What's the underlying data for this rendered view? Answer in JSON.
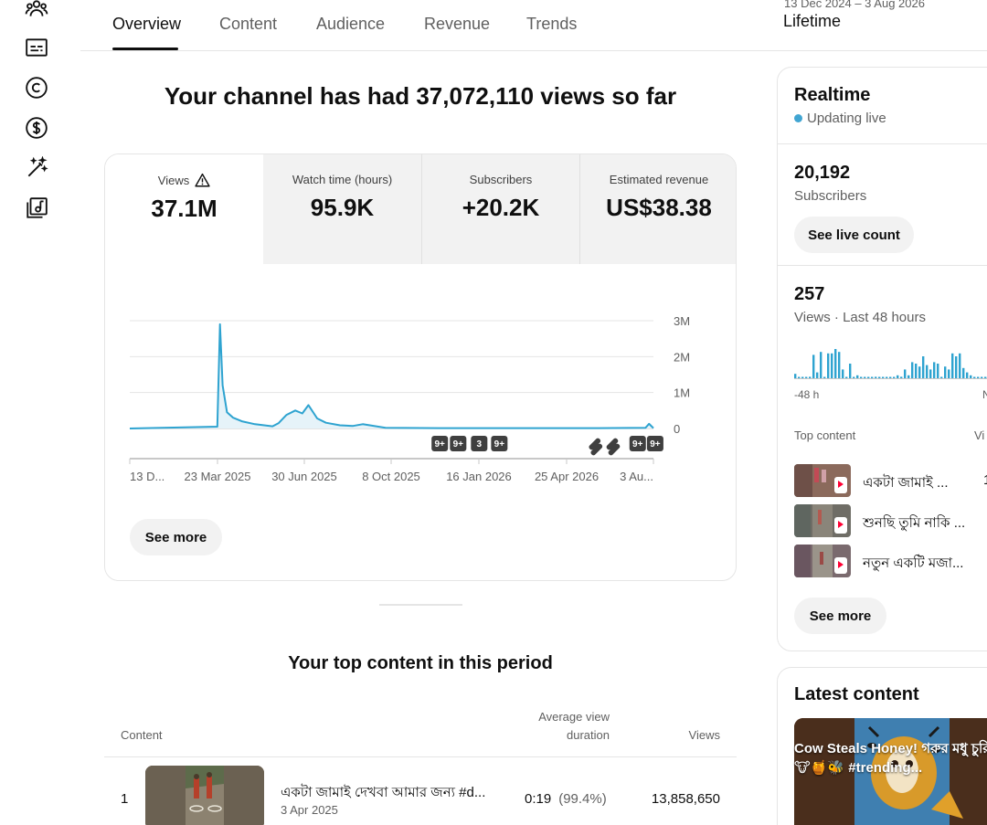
{
  "rail": {
    "icons": [
      "community-icon",
      "subtitles-icon",
      "copyright-icon",
      "earn-icon",
      "customization-icon",
      "audio-library-icon"
    ]
  },
  "tabs": [
    {
      "label": "Overview",
      "active": true
    },
    {
      "label": "Content",
      "active": false
    },
    {
      "label": "Audience",
      "active": false
    },
    {
      "label": "Revenue",
      "active": false
    },
    {
      "label": "Trends",
      "active": false
    }
  ],
  "period": {
    "range": "13 Dec 2024 – 3 Aug 2026",
    "label": "Lifetime"
  },
  "headline": "Your channel has had 37,072,110 views so far",
  "metrics": [
    {
      "label": "Views",
      "value": "37.1M",
      "active": true,
      "warning": true
    },
    {
      "label": "Watch time (hours)",
      "value": "95.9K",
      "active": false
    },
    {
      "label": "Subscribers",
      "value": "+20.2K",
      "active": false
    },
    {
      "label": "Estimated revenue",
      "value": "US$38.38",
      "active": false
    }
  ],
  "chart_data": {
    "type": "line",
    "series": [
      {
        "name": "",
        "x": [
          "13 Dec 2024",
          "23 Mar 2025",
          "26 Mar 2025",
          "29 Mar 2025",
          "3 Apr 2025",
          "10 Apr 2025",
          "20 Apr 2025",
          "5 May 2025",
          "25 May 2025",
          "1 Jun 2025",
          "10 Jun 2025",
          "20 Jun 2025",
          "28 Jun 2025",
          "5 Jul 2025",
          "15 Jul 2025",
          "25 Jul 2025",
          "10 Aug 2025",
          "25 Aug 2025",
          "5 Sep 2025",
          "1 Oct 2025",
          "1 Dec 2025",
          "1 Mar 2026",
          "1 Jun 2026",
          "25 Jul 2026",
          "29 Jul 2026",
          "3 Aug 2026"
        ],
        "values": [
          0,
          50000,
          2900000,
          1200000,
          450000,
          300000,
          200000,
          120000,
          60000,
          150000,
          380000,
          500000,
          420000,
          650000,
          280000,
          160000,
          90000,
          70000,
          120000,
          20000,
          10000,
          10000,
          10000,
          20000,
          130000,
          10000
        ]
      }
    ],
    "xticks": [
      "13 D...",
      "23 Mar 2025",
      "30 Jun 2025",
      "8 Oct 2025",
      "16 Jan 2026",
      "25 Apr 2026",
      "3 Au..."
    ],
    "yticks": [
      "3M",
      "2M",
      "1M",
      "0"
    ],
    "ylim": [
      0,
      3000000
    ],
    "grid": true,
    "markers": [
      {
        "label": "9+",
        "x": "2 Dec 2025"
      },
      {
        "label": "9+",
        "x": "23 Dec 2025"
      },
      {
        "label": "3",
        "x": "16 Jan 2026"
      },
      {
        "label": "9+",
        "x": "8 Feb 2026"
      },
      {
        "label": "",
        "x": "28 May 2026"
      },
      {
        "label": "",
        "x": "17 Jun 2026"
      },
      {
        "label": "9+",
        "x": "16 Jul 2026"
      },
      {
        "label": "9+",
        "x": "5 Aug 2026"
      }
    ],
    "line_color": "#2ea3d0"
  },
  "chart_see_more": "See more",
  "top_content": {
    "title": "Your top content in this period",
    "headers": {
      "content": "Content",
      "avd_line1": "Average view",
      "avd_line2": "duration",
      "views": "Views"
    },
    "rows": [
      {
        "rank": "1",
        "title": "একটা জামাই দেখবা আমার জন্য #d...",
        "date": "3 Apr 2025",
        "avd": "0:19",
        "avd_pct": "(99.4%)",
        "views": "13,858,650"
      }
    ]
  },
  "realtime": {
    "title": "Realtime",
    "live": "Updating live",
    "subscribers_value": "20,192",
    "subscribers_label": "Subscribers",
    "live_count_button": "See live count",
    "views_value": "257",
    "views_label": "Views · Last 48 hours",
    "axis_left": "-48 h",
    "axis_right": "N",
    "bars": [
      0.15,
      0,
      0,
      0,
      0.05,
      0.8,
      0.2,
      0.9,
      0,
      0.85,
      0.85,
      1.0,
      0.9,
      0.3,
      0,
      0.5,
      0,
      0.1,
      0,
      0,
      0,
      0,
      0.05,
      0,
      0,
      0,
      0,
      0,
      0.1,
      0.05,
      0.3,
      0.1,
      0.55,
      0.5,
      0.4,
      0.75,
      0.45,
      0.3,
      0.55,
      0.5,
      0,
      0.4,
      0.3,
      0.85,
      0.75,
      0.85,
      0.35,
      0.2,
      0.1,
      0,
      0,
      0,
      0,
      0,
      0,
      0,
      0,
      0,
      0,
      0.15
    ],
    "top_content_header": "Top content",
    "top_content_views_header": "Vi",
    "top_content": [
      {
        "title": "একটা জামাই ...",
        "value": "1"
      },
      {
        "title": "শুনছি তুমি নাকি ...",
        "value": ""
      },
      {
        "title": "নতুন একটি মজা...",
        "value": ""
      }
    ],
    "see_more": "See more"
  },
  "latest": {
    "title": "Latest content",
    "caption": "Cow Steals Honey! গরুর মধু চুরি! 🐮🍯🐝 #trending..."
  },
  "colors": {
    "accent": "#2ea3d0",
    "live": "#41a5d2",
    "shorts_badge": "#ff0033"
  }
}
